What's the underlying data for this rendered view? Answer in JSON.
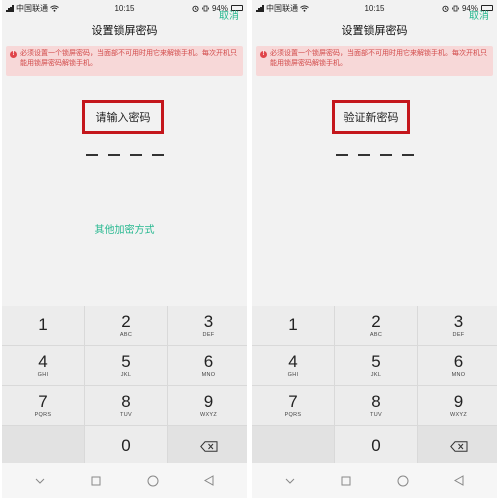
{
  "screens": [
    {
      "status": {
        "carrier": "中国联通",
        "time": "10:15",
        "battery": "94%",
        "battery_level": 0.94
      },
      "title": "设置锁屏密码",
      "cancel_label": "取消",
      "warning": {
        "text": "必须设置一个锁屏密码，当面部不可用时用它来解锁手机。每次开机只能用锁屏密码解锁手机。"
      },
      "prompt": "请输入密码",
      "other_method_label": "其他加密方式"
    },
    {
      "status": {
        "carrier": "中国联通",
        "time": "10:15",
        "battery": "94%",
        "battery_level": 0.94
      },
      "title": "设置锁屏密码",
      "cancel_label": "取消",
      "warning": {
        "text": "必须设置一个锁屏密码，当面部不可用时用它来解锁手机。每次开机只能用锁屏密码解锁手机。"
      },
      "prompt": "验证新密码"
    }
  ],
  "keypad": {
    "keys": [
      {
        "num": "1",
        "letters": ""
      },
      {
        "num": "2",
        "letters": "ABC"
      },
      {
        "num": "3",
        "letters": "DEF"
      },
      {
        "num": "4",
        "letters": "GHI"
      },
      {
        "num": "5",
        "letters": "JKL"
      },
      {
        "num": "6",
        "letters": "MNO"
      },
      {
        "num": "7",
        "letters": "PQRS"
      },
      {
        "num": "8",
        "letters": "TUV"
      },
      {
        "num": "9",
        "letters": "WXYZ"
      }
    ],
    "zero": "0"
  },
  "icons": {
    "warning": "warning-icon",
    "delete": "backspace-icon",
    "nav": [
      "nav-down-icon",
      "nav-square-icon",
      "nav-circle-icon",
      "nav-back-triangle-icon"
    ]
  },
  "colors": {
    "accent": "#27b890",
    "warning_text": "#d24a4a",
    "warning_bg": "#f7d8d8",
    "highlight_box": "#c4161c"
  }
}
